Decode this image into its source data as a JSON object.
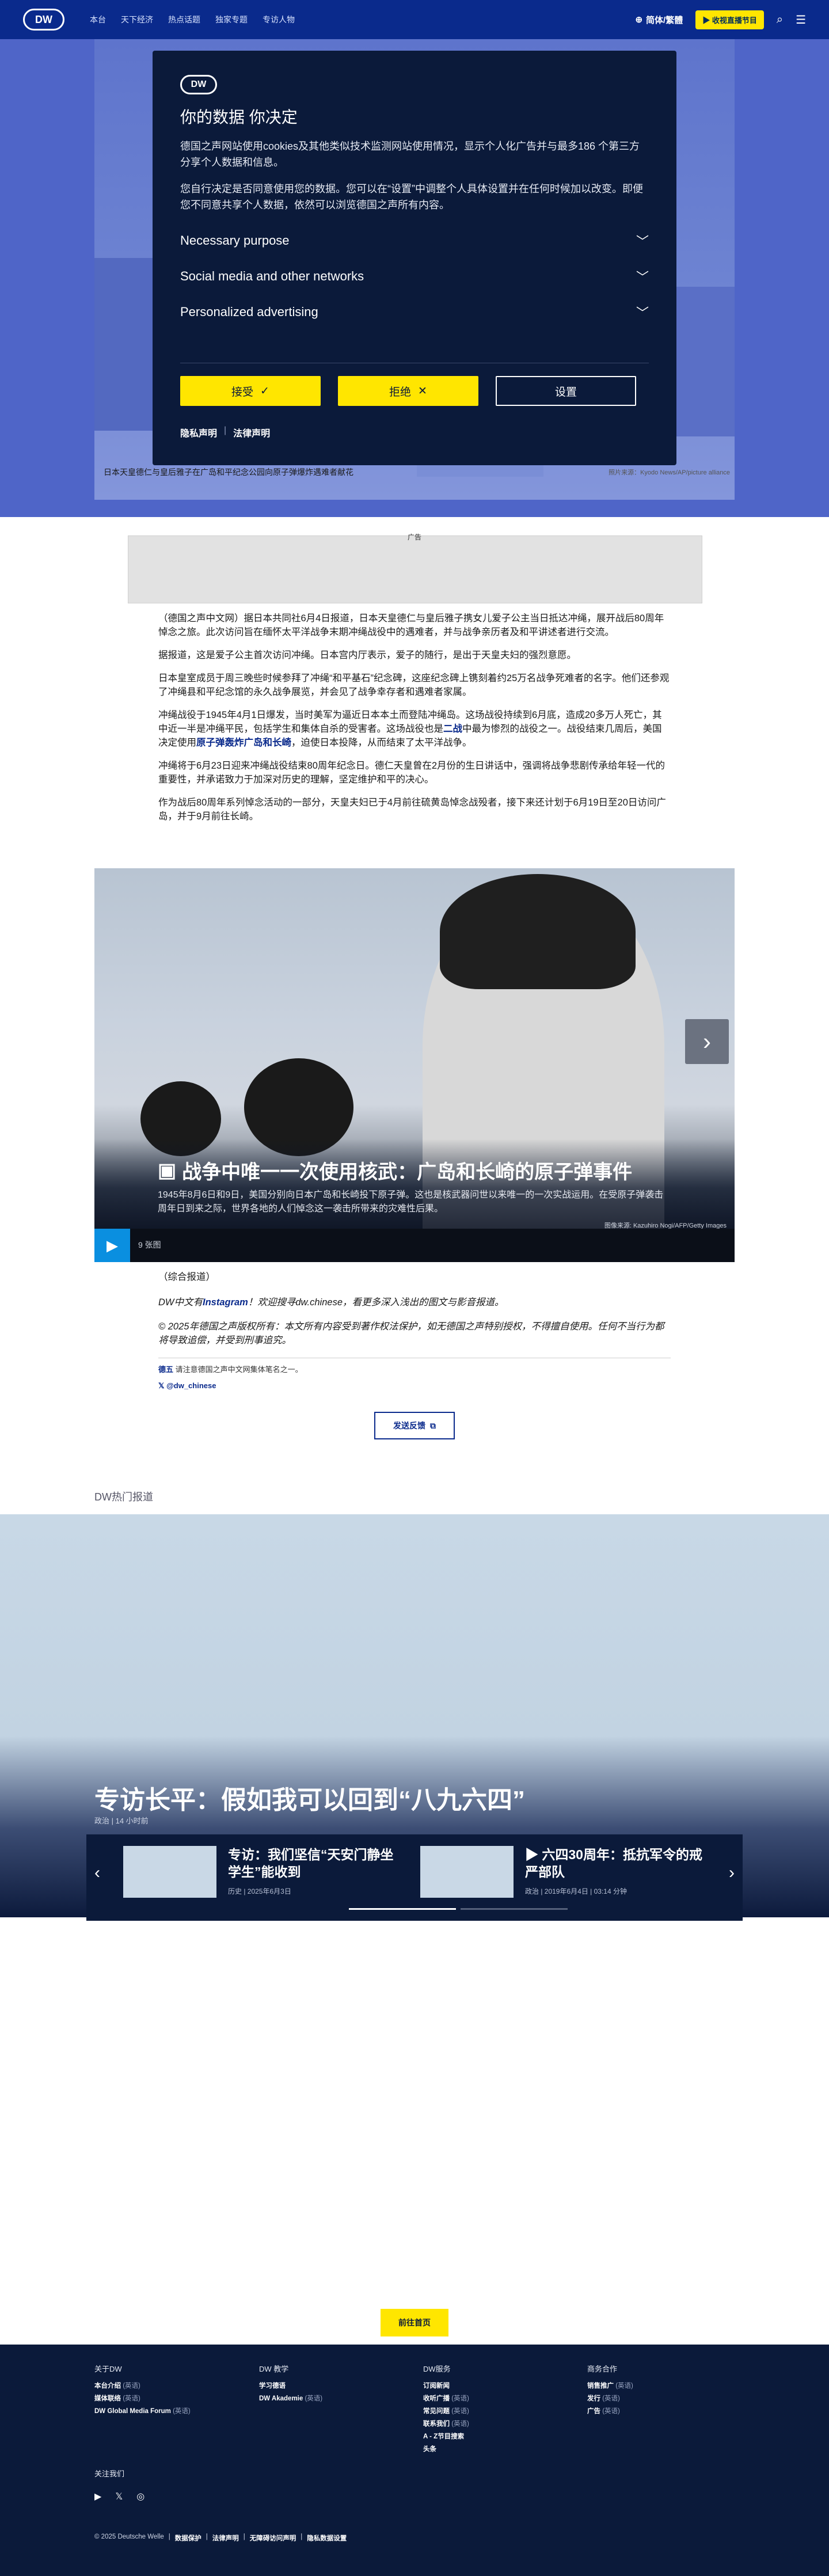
{
  "header": {
    "logo": "DW",
    "nav": [
      "本台",
      "天下经济",
      "热点话题",
      "独家专题",
      "专访人物"
    ],
    "language": "简体/繁體",
    "live": "收视直播节目"
  },
  "hero": {
    "caption": "日本天皇德仁与皇后雅子在广岛和平纪念公园向原子弹爆炸遇难者献花",
    "credit": "照片来源：Kyodo News/AP/picture alliance"
  },
  "cookie": {
    "logo": "DW",
    "title": "你的数据 你决定",
    "intro": "德国之声网站使用cookies及其他类似技术监测网站使用情况，显示个人化广告并与最多186 个第三方分享个人数据和信息。",
    "detail": "您自行决定是否同意使用您的数据。您可以在“设置”中调整个人具体设置并在任何时候加以改变。即便您不同意共享个人数据，依然可以浏览德国之声所有内容。",
    "sections": [
      "Necessary purpose",
      "Social media and other networks",
      "Personalized advertising"
    ],
    "accept": "接受",
    "reject": "拒绝",
    "settings": "设置",
    "privacy": "隐私声明",
    "legal": "法律声明"
  },
  "ad": {
    "label": "广告"
  },
  "article": {
    "p1": "（德国之声中文网）据日本共同社6月4日报道，日本天皇德仁与皇后雅子携女儿爱子公主当日抵达冲绳，展开战后80周年悼念之旅。此次访问旨在缅怀太平洋战争末期冲绳战役中的遇难者，并与战争亲历者及和平讲述者进行交流。",
    "p2": "据报道，这是爱子公主首次访问冲绳。日本宫内厅表示，爱子的随行，是出于天皇夫妇的强烈意愿。",
    "p3": "日本皇室成员于周三晚些时候参拜了冲绳“和平基石”纪念碑，这座纪念碑上镌刻着约25万名战争死难者的名字。他们还参观了冲绳县和平纪念馆的永久战争展览，并会见了战争幸存者和遇难者家属。",
    "p4a": "冲绳战役于1945年4月1日爆发，当时美军为逼近日本本土而登陆冲绳岛。这场战役持续到6月底，造成20多万人死亡，其中近一半是冲绳平民，包括学生和集体自杀的受害者。这场战役也是",
    "p4link1": "二战",
    "p4b": "中最为惨烈的战役之一。战役结束几周后，美国决定使用",
    "p4link2": "原子弹轰炸广岛和长崎",
    "p4c": "，迫使日本投降，从而结束了太平洋战争。",
    "p5": "冲绳将于6月23日迎来冲绳战役结束80周年纪念日。德仁天皇曾在2月份的生日讲话中，强调将战争悲剧传承给年轻一代的重要性，并承诺致力于加深对历史的理解，坚定维护和平的决心。",
    "p6": "作为战后80周年系列悼念活动的一部分，天皇夫妇已于4月前往硫黄岛悼念战殁者，接下来还计划于6月19日至20日访问广岛，并于9月前往长崎。"
  },
  "gallery": {
    "title": "战争中唯一一次使用核武：广岛和长崎的原子弹事件",
    "desc": "1945年8月6日和9日，美国分别向日本广岛和长崎投下原子弹。这也是核武器问世以来唯一的一次实战运用。在受原子弹袭击周年日到来之际，世界各地的人们悼念这一袭击所带来的灾难性后果。",
    "credit": "图像来源: Kazuhiro Nogi/AFP/Getty Images",
    "count": "9 张图"
  },
  "post": {
    "source": "（综合报道）",
    "promo_a": "DW中文有",
    "promo_link": "Instagram",
    "promo_b": "！欢迎搜寻dw.chinese，看更多深入浅出的图文与影音报道。",
    "copyright": "© 2025年德国之声版权所有：本文所有内容受到著作权法保护，如无德国之声特别授权，不得擅自使用。任何不当行为都将导致追偿，并受到刑事追究。",
    "follow_b": "德五",
    "follow": "请注意德国之声中文网集体笔名之一。",
    "x_handle": "@dw_chinese",
    "feedback": "发送反馈"
  },
  "hot": {
    "label": "DW热门报道",
    "title": "专访长平：假如我可以回到“八九六四”",
    "meta": "政治 | 14 小时前",
    "cards": [
      {
        "title": "专访：我们坚信“天安门静坐学生”能收到",
        "meta": "历史 | 2025年6月3日"
      },
      {
        "title": "六四30周年：抵抗军令的戒严部队",
        "meta": "政治 | 2019年6月4日 | 03:14 分钟"
      }
    ]
  },
  "home_button": "前往首页",
  "footer": {
    "cols": [
      {
        "heading": "关于DW",
        "items": [
          [
            "本台介绍",
            "(英语)"
          ],
          [
            "媒体联络",
            "(英语)"
          ],
          [
            "DW Global Media Forum",
            "(英语)"
          ]
        ]
      },
      {
        "heading": "DW 教学",
        "items": [
          [
            "学习德语",
            ""
          ],
          [
            "DW Akademie",
            "(英语)"
          ]
        ]
      },
      {
        "heading": "DW服务",
        "items": [
          [
            "订阅新闻",
            ""
          ],
          [
            "收听广播",
            "(英语)"
          ],
          [
            "常见问题",
            "(英语)"
          ],
          [
            "联系我们",
            "(英语)"
          ],
          [
            "A - Z节目搜索",
            ""
          ],
          [
            "头条",
            ""
          ]
        ]
      },
      {
        "heading": "商务合作",
        "items": [
          [
            "销售推广",
            "(英语)"
          ],
          [
            "发行",
            "(英语)"
          ],
          [
            "广告",
            "(英语)"
          ]
        ]
      }
    ],
    "follow": "关注我们",
    "legal": [
      "© 2025 Deutsche Welle",
      "数据保护",
      "法律声明",
      "无障碍访问声明",
      "隐私数据设置"
    ]
  }
}
